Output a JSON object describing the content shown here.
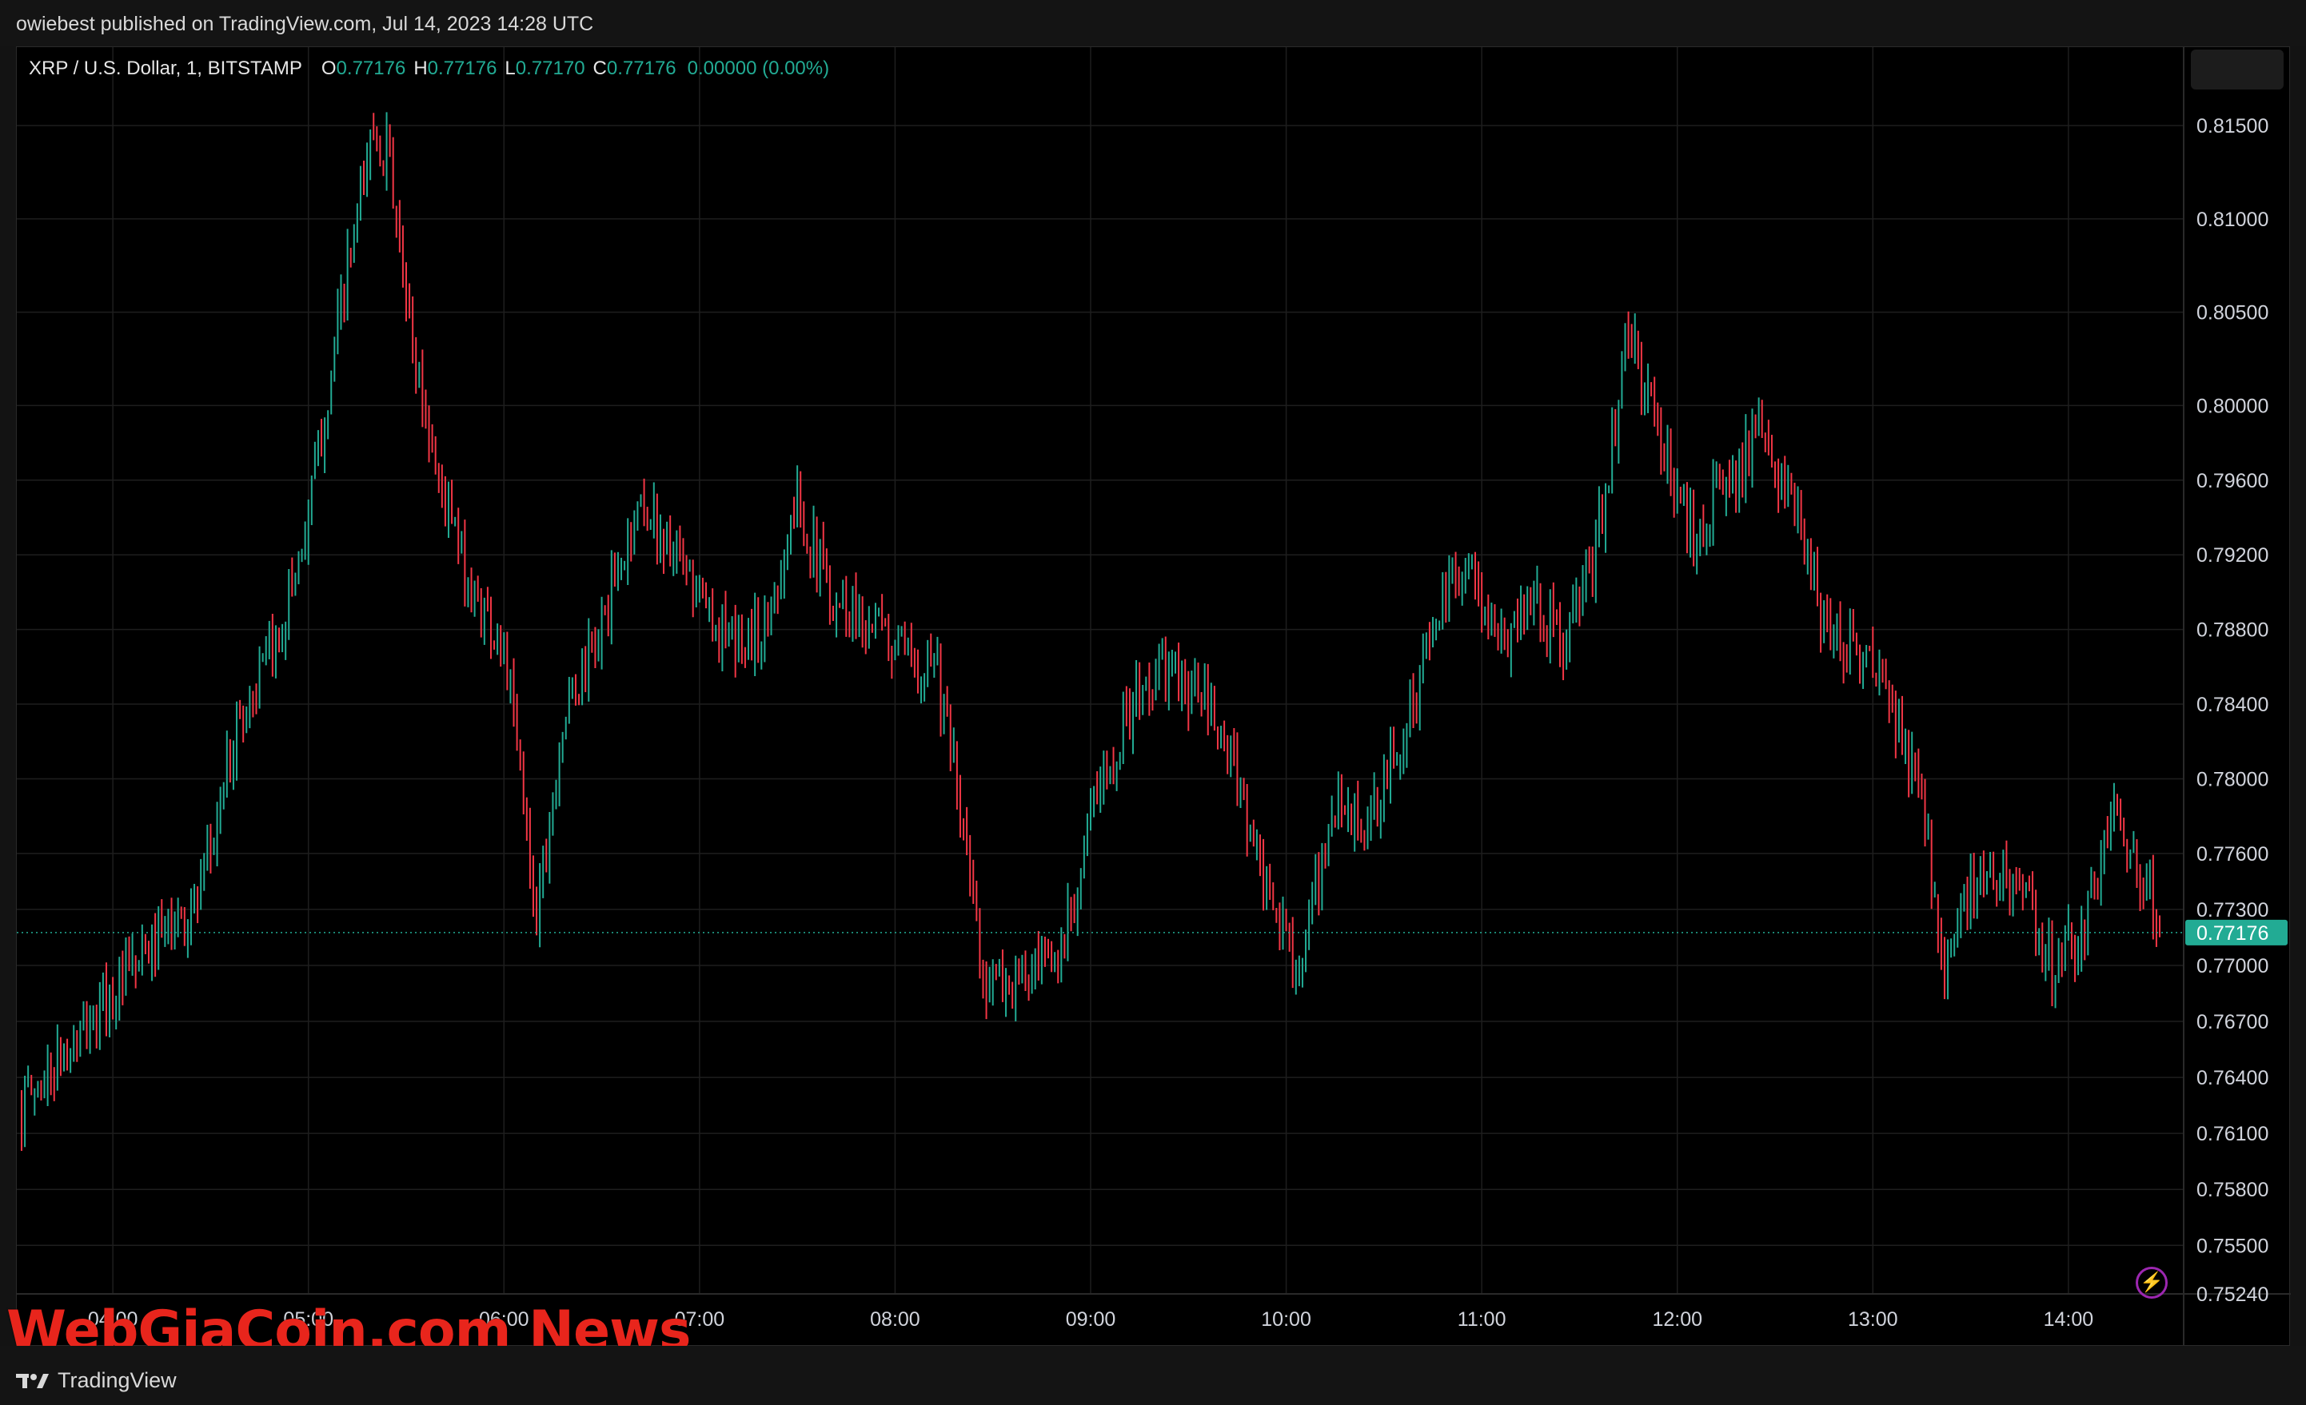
{
  "header": {
    "published": "owiebest published on TradingView.com, Jul 14, 2023 14:28 UTC"
  },
  "legend": {
    "symbol": "XRP / U.S. Dollar, 1, BITSTAMP",
    "o_label": "O",
    "o_value": "0.77176",
    "h_label": "H",
    "h_value": "0.77176",
    "l_label": "L",
    "l_value": "0.77170",
    "c_label": "C",
    "c_value": "0.77176",
    "change": "0.00000 (0.00%)"
  },
  "watermark": "WebGiaCoin.com News",
  "footer": {
    "brand": "TradingView"
  },
  "colors": {
    "up": "#22ab94",
    "down": "#f23645",
    "background": "#000000",
    "grid": "#1e1e1e",
    "axis_text": "#d1d4dc",
    "last_price_bg": "#22ab94"
  },
  "icons": {
    "bolt": "lightning-bolt-icon",
    "logo": "tradingview-logo-icon"
  },
  "chart_data": {
    "type": "candlestick",
    "title": "XRP / U.S. Dollar, 1, BITSTAMP",
    "interval": "1 minute",
    "y_ticks": [
      "0.81500",
      "0.81000",
      "0.80500",
      "0.80000",
      "0.79600",
      "0.79200",
      "0.78800",
      "0.78400",
      "0.78000",
      "0.77600",
      "0.77300",
      "0.77000",
      "0.76700",
      "0.76400",
      "0.76100",
      "0.75800",
      "0.75500",
      "0.75240"
    ],
    "x_ticks": [
      "04:00",
      "05:00",
      "06:00",
      "07:00",
      "08:00",
      "09:00",
      "10:00",
      "11:00",
      "12:00",
      "13:00",
      "14:00"
    ],
    "x_range": [
      "03:32",
      "14:28"
    ],
    "ylim": [
      0.7524,
      0.8192
    ],
    "last_price": 0.77176,
    "last_price_label": "0.77176",
    "grid": true,
    "keypoints": [
      [
        "03:32",
        0.7625
      ],
      [
        "03:50",
        0.7662
      ],
      [
        "04:10",
        0.7705
      ],
      [
        "04:27",
        0.7735
      ],
      [
        "04:38",
        0.783
      ],
      [
        "04:50",
        0.787
      ],
      [
        "05:00",
        0.794
      ],
      [
        "05:10",
        0.805
      ],
      [
        "05:20",
        0.815
      ],
      [
        "05:25",
        0.813
      ],
      [
        "05:30",
        0.805
      ],
      [
        "05:40",
        0.796
      ],
      [
        "05:50",
        0.79
      ],
      [
        "06:00",
        0.787
      ],
      [
        "06:10",
        0.773
      ],
      [
        "06:18",
        0.783
      ],
      [
        "06:30",
        0.788
      ],
      [
        "06:42",
        0.795
      ],
      [
        "06:55",
        0.791
      ],
      [
        "07:10",
        0.787
      ],
      [
        "07:20",
        0.788
      ],
      [
        "07:30",
        0.795
      ],
      [
        "07:40",
        0.79
      ],
      [
        "07:55",
        0.788
      ],
      [
        "08:05",
        0.786
      ],
      [
        "08:12",
        0.787
      ],
      [
        "08:20",
        0.778
      ],
      [
        "08:28",
        0.769
      ],
      [
        "08:38",
        0.769
      ],
      [
        "08:50",
        0.77
      ],
      [
        "09:00",
        0.778
      ],
      [
        "09:10",
        0.783
      ],
      [
        "09:22",
        0.786
      ],
      [
        "09:35",
        0.784
      ],
      [
        "09:45",
        0.78
      ],
      [
        "09:55",
        0.773
      ],
      [
        "10:05",
        0.77
      ],
      [
        "10:15",
        0.779
      ],
      [
        "10:25",
        0.777
      ],
      [
        "10:35",
        0.782
      ],
      [
        "10:45",
        0.788
      ],
      [
        "10:55",
        0.792
      ],
      [
        "11:05",
        0.787
      ],
      [
        "11:15",
        0.79
      ],
      [
        "11:25",
        0.787
      ],
      [
        "11:35",
        0.792
      ],
      [
        "11:45",
        0.804
      ],
      [
        "11:55",
        0.798
      ],
      [
        "12:05",
        0.793
      ],
      [
        "12:15",
        0.796
      ],
      [
        "12:25",
        0.798
      ],
      [
        "12:35",
        0.795
      ],
      [
        "12:45",
        0.788
      ],
      [
        "12:55",
        0.787
      ],
      [
        "13:05",
        0.784
      ],
      [
        "13:15",
        0.779
      ],
      [
        "13:22",
        0.77
      ],
      [
        "13:30",
        0.774
      ],
      [
        "13:42",
        0.775
      ],
      [
        "13:55",
        0.77
      ],
      [
        "14:05",
        0.772
      ],
      [
        "14:15",
        0.779
      ],
      [
        "14:20",
        0.776
      ],
      [
        "14:28",
        0.7718
      ]
    ]
  }
}
